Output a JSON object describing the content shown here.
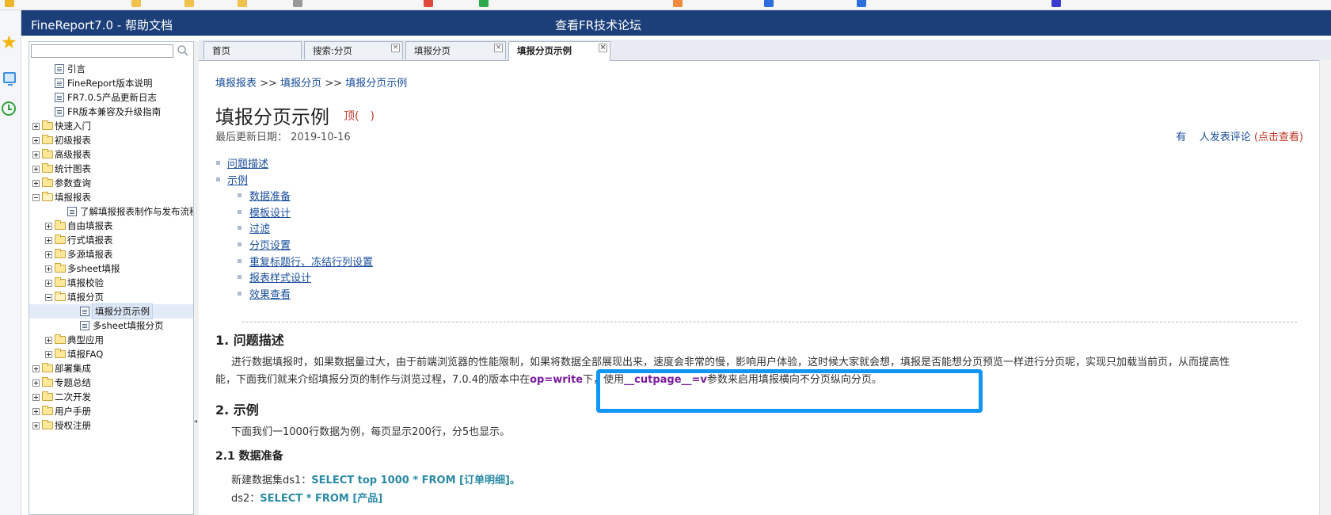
{
  "header": {
    "app_title": "FineReport7.0 - 帮助文档",
    "forum_link": "查看FR技术论坛"
  },
  "sidebar": {
    "search_placeholder": "",
    "tree": [
      {
        "label": "引言",
        "type": "doc",
        "level": 1
      },
      {
        "label": "FineReport版本说明",
        "type": "doc",
        "level": 1
      },
      {
        "label": "FR7.0.5产品更新日志",
        "type": "doc",
        "level": 1
      },
      {
        "label": "FR版本兼容及升级指南",
        "type": "doc",
        "level": 1
      },
      {
        "label": "快速入门",
        "type": "folder",
        "level": 0
      },
      {
        "label": "初级报表",
        "type": "folder",
        "level": 0
      },
      {
        "label": "高级报表",
        "type": "folder",
        "level": 0
      },
      {
        "label": "统计图表",
        "type": "folder",
        "level": 0
      },
      {
        "label": "参数查询",
        "type": "folder",
        "level": 0
      },
      {
        "label": "填报报表",
        "type": "folder-open",
        "level": 0
      },
      {
        "label": "了解填报报表制作与发布流程",
        "type": "doc",
        "level": 2
      },
      {
        "label": "自由填报表",
        "type": "folder",
        "level": 1
      },
      {
        "label": "行式填报表",
        "type": "folder",
        "level": 1
      },
      {
        "label": "多源填报表",
        "type": "folder",
        "level": 1
      },
      {
        "label": "多sheet填报",
        "type": "folder",
        "level": 1
      },
      {
        "label": "填报校验",
        "type": "folder",
        "level": 1
      },
      {
        "label": "填报分页",
        "type": "folder-open",
        "level": 1
      },
      {
        "label": "填报分页示例",
        "type": "doc",
        "level": 3,
        "selected": true
      },
      {
        "label": "多sheet填报分页",
        "type": "doc",
        "level": 3
      },
      {
        "label": "典型应用",
        "type": "folder",
        "level": 1
      },
      {
        "label": "填报FAQ",
        "type": "folder",
        "level": 1
      },
      {
        "label": "部署集成",
        "type": "folder",
        "level": 0
      },
      {
        "label": "专题总结",
        "type": "folder",
        "level": 0
      },
      {
        "label": "二次开发",
        "type": "folder",
        "level": 0
      },
      {
        "label": "用户手册",
        "type": "folder",
        "level": 0
      },
      {
        "label": "授权注册",
        "type": "folder",
        "level": 0
      }
    ]
  },
  "tabs": [
    {
      "label": "首页",
      "closable": false,
      "active": false
    },
    {
      "label": "搜索:分页",
      "closable": true,
      "active": false
    },
    {
      "label": "填报分页",
      "closable": true,
      "active": false
    },
    {
      "label": "填报分页示例",
      "closable": true,
      "active": true
    }
  ],
  "content": {
    "breadcrumb": [
      "填报报表",
      "填报分页",
      "填报分页示例"
    ],
    "breadcrumb_sep": ">>",
    "title": "填报分页示例",
    "ding": "顶(　)",
    "updated_label": "最后更新日期：",
    "updated_date": "2019-10-16",
    "comments": {
      "prefix": "有",
      "middle": "人发表评论",
      "link": "(点击查看)"
    },
    "toc": [
      {
        "label": "问题描述",
        "level": 0
      },
      {
        "label": "示例",
        "level": 0
      },
      {
        "label": "数据准备",
        "level": 1
      },
      {
        "label": "模板设计",
        "level": 1
      },
      {
        "label": "过滤",
        "level": 1
      },
      {
        "label": "分页设置",
        "level": 1
      },
      {
        "label": "重复标题行、冻结行列设置",
        "level": 1
      },
      {
        "label": "报表样式设计",
        "level": 1
      },
      {
        "label": "效果查看",
        "level": 1
      }
    ],
    "section1_title": "1. 问题描述",
    "section1_line1": "进行数据填报时，如果数据量过大，由于前端浏览器的性能限制，如果将数据全部展现出来，速度会非常的慢，影响用户体验，这时候大家就会想，填报是否能想分页预览一样进行分页呢，实现只加载当前页，从而提高性",
    "section1_line2_a": "能，下面我们就来介绍填报分页的制作与浏览过程，7.0.4的版本中在",
    "section1_kw1": "op=write",
    "section1_line2_b": "下，使用",
    "section1_kw2": "__cutpage__=v",
    "section1_line2_c": "参数来启用填报横向不分页纵向分页。",
    "section2_title": "2. 示例",
    "section2_text": "下面我们一1000行数据为例，每页显示200行，分5也显示。",
    "section21_title": "2.1 数据准备",
    "ds1_label": "新建数据集ds1：",
    "ds1_sql": "SELECT top 1000 * FROM [订单明细]。",
    "ds2_label": "ds2：",
    "ds2_sql": "SELECT * FROM [产品]"
  }
}
